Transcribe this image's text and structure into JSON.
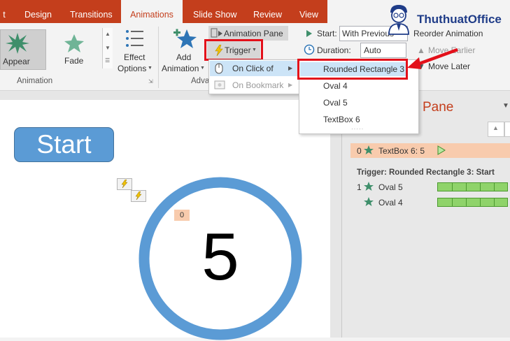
{
  "tabs": [
    {
      "label": "t"
    },
    {
      "label": "Design"
    },
    {
      "label": "Transitions"
    },
    {
      "label": "Animations"
    },
    {
      "label": "Slide Show"
    },
    {
      "label": "Review"
    },
    {
      "label": "View"
    }
  ],
  "ribbon": {
    "appear": "Appear",
    "fade": "Fade",
    "effect_options_1": "Effect",
    "effect_options_2": "Options",
    "add_animation_1": "Add",
    "add_animation_2": "Animation",
    "animation_pane": "Animation Pane",
    "trigger": "Trigger",
    "start_label": "Start:",
    "start_value": "With Previous",
    "duration_label": "Duration:",
    "duration_value": "Auto",
    "reorder": "Reorder Animation",
    "move_earlier": "Move Earlier",
    "move_later": "Move Later",
    "group_animation": "Animation",
    "group_advanced": "Adva"
  },
  "trigger_menu": {
    "on_click_of": "On Click of",
    "on_bookmark": "On Bookmark"
  },
  "submenu": {
    "items": [
      "Rounded Rectangle 3",
      "Oval 4",
      "Oval 5",
      "TextBox 6"
    ]
  },
  "slide": {
    "start_button": "Start",
    "number": "5",
    "tag": "0"
  },
  "pane": {
    "title": "Pane",
    "item0_num": "0",
    "item0_label": "TextBox 6: 5",
    "trigger_heading": "Trigger: Rounded Rectangle 3: Start",
    "oval5_num": "1",
    "oval5_label": "Oval 5",
    "oval4_label": "Oval 4"
  },
  "logo": {
    "text": "ThuthuatOffice"
  },
  "colors": {
    "tab_red": "#c43e1c",
    "highlight_red": "#e3101a",
    "shape_blue": "#5b9bd5",
    "star_green": "#3f8f6b"
  }
}
